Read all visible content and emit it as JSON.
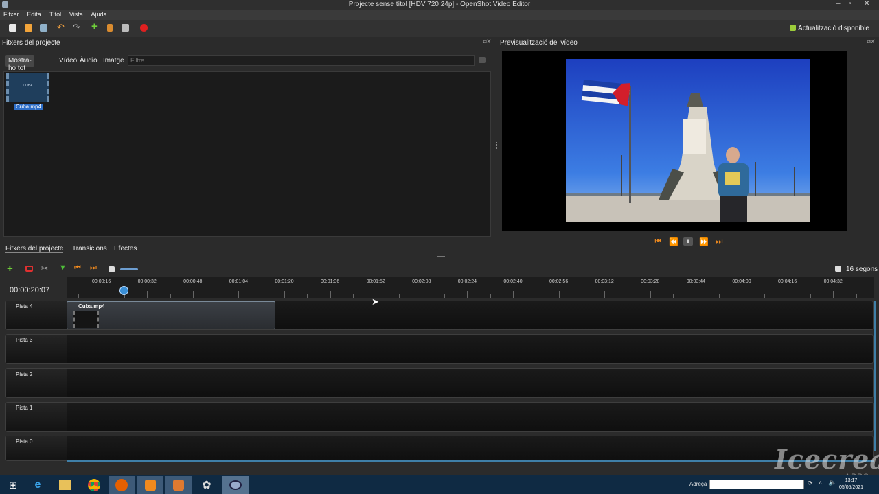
{
  "window": {
    "title": "Projecte sense títol [HDV 720 24p] - OpenShot Video Editor",
    "minimize": "–",
    "maximize": "▫",
    "close": "✕"
  },
  "menu": [
    "Fitxer",
    "Edita",
    "Títol",
    "Vista",
    "Ajuda"
  ],
  "toolbar": {
    "icons": [
      "new-project-icon",
      "open-project-icon",
      "save-project-icon",
      "undo-icon",
      "redo-icon",
      "import-files-icon",
      "profile-icon",
      "fullscreen-icon",
      "export-video-icon"
    ],
    "update_label": "Actualització disponible"
  },
  "files_panel": {
    "title": "Fitxers del projecte",
    "filters": [
      "Mostra-ho tot",
      "Vídeo",
      "Àudio",
      "Imatge"
    ],
    "active_filter": "Mostra-ho tot",
    "filter_placeholder": "Filtre",
    "items": [
      {
        "name": "Cuba.mp4",
        "thumb_text": "CUBA"
      }
    ]
  },
  "preview_panel": {
    "title": "Previsualització del vídeo"
  },
  "bottom_tabs": [
    "Fitxers del projecte",
    "Transicions",
    "Efectes"
  ],
  "timeline": {
    "zoom_label": "16 segons",
    "timecode": "00:00:20:07",
    "ruler_labels": [
      "00:00:16",
      "00:00:32",
      "00:00:48",
      "00:01:04",
      "00:01:20",
      "00:01:36",
      "00:01:52",
      "00:02:08",
      "00:02:24",
      "00:02:40",
      "00:02:56",
      "00:03:12",
      "00:03:28",
      "00:03:44",
      "00:04:00",
      "00:04:16",
      "00:04:32"
    ],
    "tracks": [
      "Pista 4",
      "Pista 3",
      "Pista 2",
      "Pista 1",
      "Pista 0"
    ],
    "clip": {
      "name": "Cuba.mp4",
      "track": "Pista 4"
    }
  },
  "taskbar": {
    "address_label": "Adreça",
    "time": "13:17",
    "date": "05/05/2021"
  },
  "watermark": {
    "brand": "Icecream",
    "sub": "APPS"
  }
}
